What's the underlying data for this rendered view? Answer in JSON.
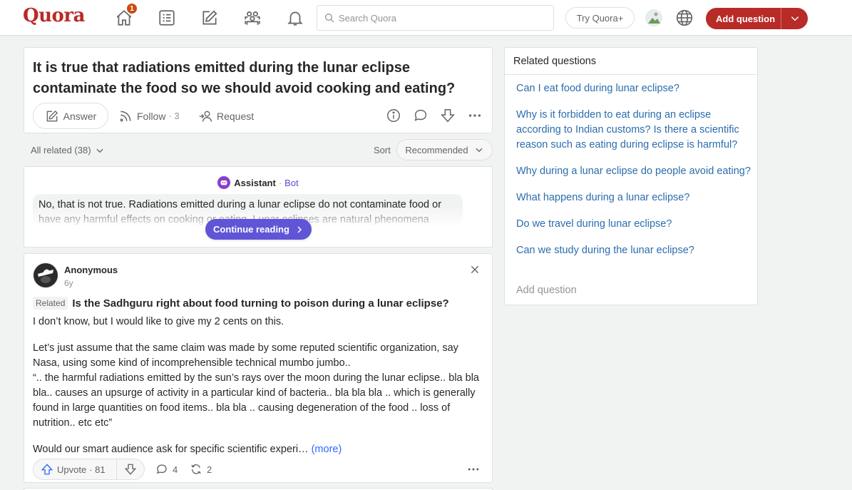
{
  "header": {
    "logo": "Quora",
    "notification_badge": "1",
    "search_placeholder": "Search Quora",
    "try_label": "Try Quora+",
    "add_question_label": "Add question",
    "brand_color": "#b92b27",
    "nav_icons": [
      "home-icon",
      "following-icon",
      "answer-icon",
      "spaces-icon",
      "notifications-icon"
    ]
  },
  "question": {
    "title": "It is true that radiations emitted during the lunar eclipse contaminate the food so we should avoid cooking and eating?",
    "answer_label": "Answer",
    "follow_label": "Follow",
    "follow_count": "· 3",
    "request_label": "Request"
  },
  "filters": {
    "all_related": "All related (38)",
    "sort_label": "Sort",
    "sort_value": "Recommended"
  },
  "bot": {
    "name": "Assistant",
    "dot": "·",
    "tag": "Bot",
    "text": "No, that is not true. Radiations emitted during a lunar eclipse do not contaminate food or have any harmful effects on cooking or eating. Lunar eclipses are natural phenomena",
    "continue_label": "Continue reading",
    "accent_color": "#5f55d6"
  },
  "answer": {
    "author": "Anonymous",
    "time": "6y",
    "related_tag": "Related",
    "question_title": "Is the Sadhguru right about food turning to poison during a lunar eclipse?",
    "paragraphs": [
      "I don’t know, but I would like to give my 2 cents on this.",
      "Let’s just assume that the same claim was made by some reputed scientific organization, say Nasa, using some kind of incomprehensible technical mumbo jumbo..",
      "“.. the harmful radiations emitted by the sun’s rays over the moon during the lunar eclipse.. bla bla bla.. causes an upsurge of activity in a particular kind of bacteria.. bla bla bla .. which is generally found in large quantities on food items.. bla bla .. causing degeneration of the food .. loss of nutrition.. etc etc”",
      "Would our smart audience ask for specific scientific experi…"
    ],
    "more_label": "(more)",
    "upvote_label": "Upvote",
    "upvote_count": "· 81",
    "comment_count": "4",
    "share_count": "2"
  },
  "related": {
    "heading": "Related questions",
    "items": [
      "Can I eat food during lunar eclipse?",
      "Why is it forbidden to eat during an eclipse according to Indian customs? Is there a scientific reason such as eating during eclipse is harmful?",
      "Why during a lunar eclipse do people avoid eating?",
      "What happens during a lunar eclipse?",
      "Do we travel during lunar eclipse?",
      "Can we study during the lunar eclipse?"
    ],
    "add_label": "Add question",
    "link_color": "#2b6dad"
  }
}
